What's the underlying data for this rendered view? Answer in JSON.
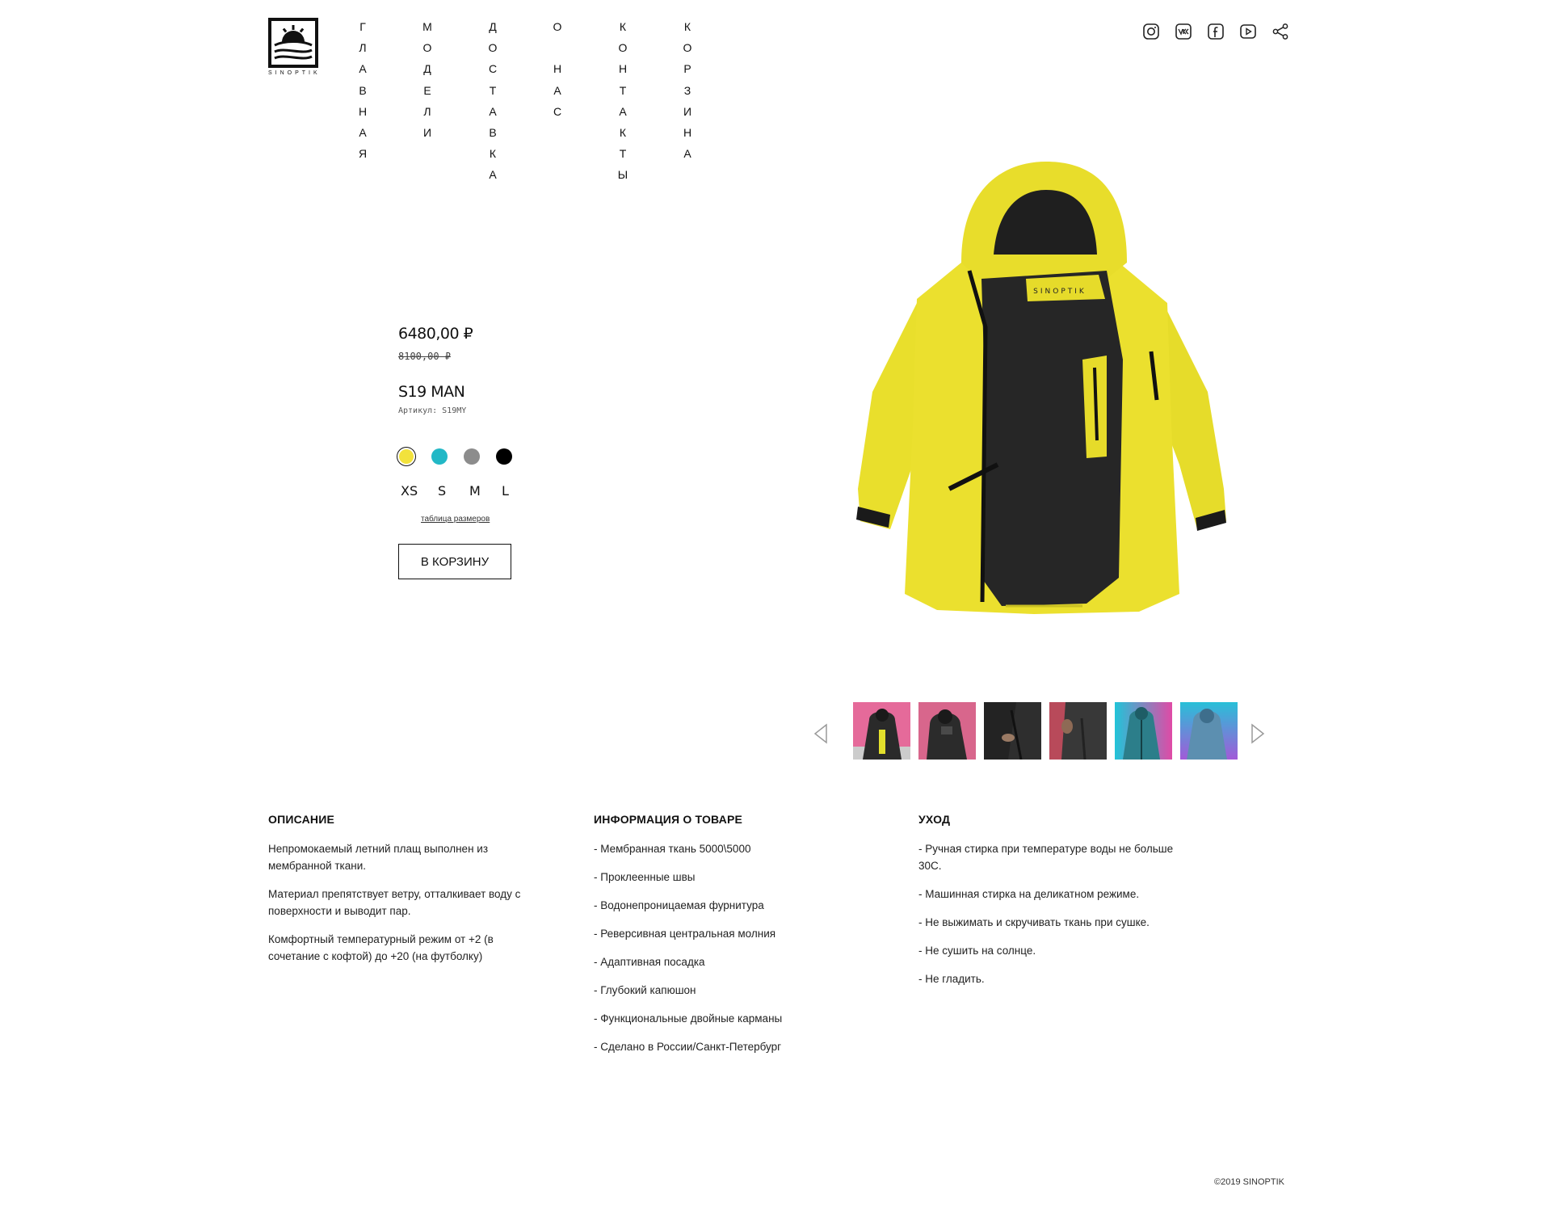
{
  "header": {
    "logo_text": "SINOPTIK",
    "nav": [
      "Главная",
      "Модели",
      "Доставка",
      "О нас",
      "Контакты",
      "Корзина"
    ],
    "socials": [
      "instagram-icon",
      "vk-icon",
      "facebook-icon",
      "youtube-icon",
      "share-icon"
    ]
  },
  "product": {
    "price": "6480,00 ₽",
    "old_price": "8100,00 ₽",
    "name": "S19 MAN",
    "sku_label": "Артикул:",
    "sku": "S19MY",
    "colors": [
      "#f2e23c",
      "#22b8c6",
      "#8c8c8c",
      "#000000"
    ],
    "selected_color": 0,
    "sizes": [
      "XS",
      "S",
      "M",
      "L"
    ],
    "selected_size": "S",
    "size_table_link": "таблица размеров",
    "add_to_cart": "В КОРЗИНУ"
  },
  "gallery": {
    "thumbnail_count": 6
  },
  "details": {
    "description": {
      "title": "ОПИСАНИЕ",
      "paragraphs": [
        "Непромокаемый летний плащ выполнен из мембранной ткани.",
        "Материал препятствует ветру, отталкивает воду с поверхности и выводит пар.",
        "Комфортный температурный режим от +2 (в сочетание с кофтой) до +20 (на футболку)"
      ]
    },
    "info": {
      "title": "ИНФОРМАЦИЯ О ТОВАРЕ",
      "items": [
        "- Мембранная ткань 5000\\5000",
        "- Проклеенные швы",
        "- Водонепроницаемая фурнитура",
        "- Реверсивная центральная молния",
        "- Адаптивная посадка",
        "- Глубокий капюшон",
        "- Функциональные двойные карманы",
        "- Сделано в России/Санкт-Петербург"
      ]
    },
    "care": {
      "title": "УХОД",
      "items": [
        "- Ручная стирка при температуре воды не больше 30С.",
        "- Машинная стирка на деликатном режиме.",
        "- Не выжимать и скручивать ткань при сушке.",
        "- Не сушить на солнце.",
        "- Не гладить."
      ]
    }
  },
  "footer": {
    "copyright": "©2019  SINOPTIK"
  }
}
